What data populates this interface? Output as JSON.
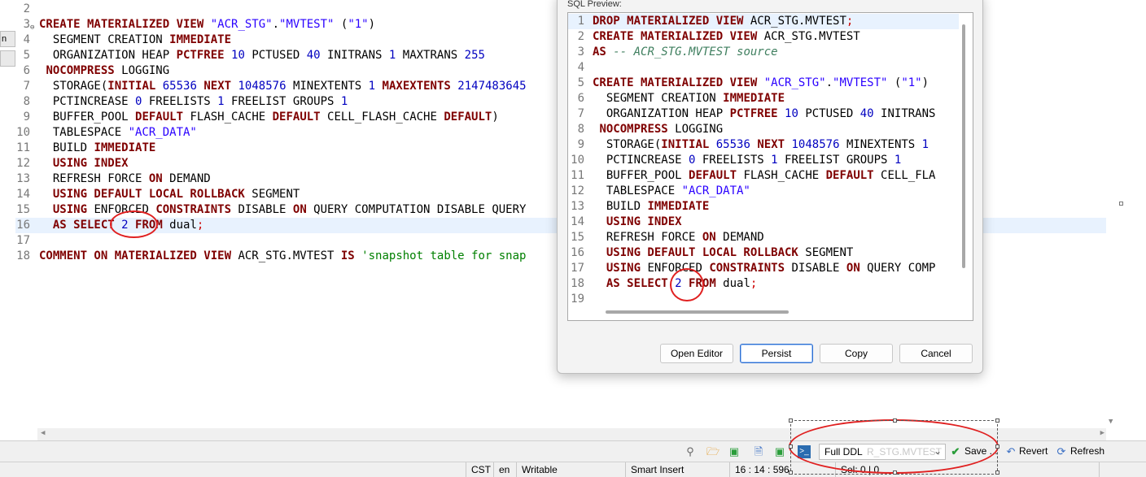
{
  "left_tabs": [
    "n",
    ""
  ],
  "editor": {
    "lines": [
      {
        "n": "2",
        "html": ""
      },
      {
        "n": "3",
        "html": "<span class=\"kw\">CREATE MATERIALIZED VIEW</span> <span class=\"str\">\"ACR_STG\"</span>.<span class=\"str\">\"MVTEST\"</span> (<span class=\"str\">\"1\"</span>)"
      },
      {
        "n": "4",
        "html": "  SEGMENT CREATION <span class=\"kw\">IMMEDIATE</span>"
      },
      {
        "n": "5",
        "html": "  ORGANIZATION HEAP <span class=\"kw\">PCTFREE</span> <span class=\"num\">10</span> PCTUSED <span class=\"num\">40</span> INITRANS <span class=\"num\">1</span> MAXTRANS <span class=\"num\">255</span>"
      },
      {
        "n": "6",
        "html": " <span class=\"kw\">NOCOMPRESS</span> LOGGING"
      },
      {
        "n": "7",
        "html": "  STORAGE(<span class=\"kw\">INITIAL</span> <span class=\"num\">65536</span> <span class=\"kw\">NEXT</span> <span class=\"num\">1048576</span> MINEXTENTS <span class=\"num\">1</span> <span class=\"kw\">MAXEXTENTS</span> <span class=\"num\">2147483645</span>"
      },
      {
        "n": "8",
        "html": "  PCTINCREASE <span class=\"num\">0</span> FREELISTS <span class=\"num\">1</span> FREELIST GROUPS <span class=\"num\">1</span>"
      },
      {
        "n": "9",
        "html": "  BUFFER_POOL <span class=\"kw\">DEFAULT</span> FLASH_CACHE <span class=\"kw\">DEFAULT</span> CELL_FLASH_CACHE <span class=\"kw\">DEFAULT</span>)"
      },
      {
        "n": "10",
        "html": "  TABLESPACE <span class=\"str\">\"ACR_DATA\"</span>"
      },
      {
        "n": "11",
        "html": "  BUILD <span class=\"kw\">IMMEDIATE</span>"
      },
      {
        "n": "12",
        "html": "  <span class=\"kw\">USING INDEX</span>"
      },
      {
        "n": "13",
        "html": "  REFRESH FORCE <span class=\"kw\">ON</span> DEMAND"
      },
      {
        "n": "14",
        "html": "  <span class=\"kw\">USING DEFAULT LOCAL ROLLBACK</span> SEGMENT"
      },
      {
        "n": "15",
        "html": "  <span class=\"kw\">USING</span> ENFORCED <span class=\"kw\">CONSTRAINTS</span> DISABLE <span class=\"kw\">ON</span> QUERY COMPUTATION DISABLE QUERY"
      },
      {
        "n": "16",
        "html": "  <span class=\"kw\">AS SELECT</span> <span class=\"num\">2</span> <span class=\"kw\">FROM</span> dual<span class=\"semi\">;</span>"
      },
      {
        "n": "17",
        "html": ""
      },
      {
        "n": "18",
        "html": "<span class=\"kw\">COMMENT ON MATERIALIZED VIEW</span> ACR_STG.MVTEST <span class=\"kw\">IS</span> <span class=\"gstr\">'snapshot table for snap</span>"
      }
    ]
  },
  "dialog": {
    "label": "SQL Preview:",
    "lines": [
      {
        "n": "1",
        "html": "<span class=\"kw\">DROP MATERIALIZED VIEW</span> ACR_STG.MVTEST<span class=\"semi\">;</span>"
      },
      {
        "n": "2",
        "html": "<span class=\"kw\">CREATE MATERIALIZED VIEW</span> ACR_STG.MVTEST"
      },
      {
        "n": "3",
        "html": "<span class=\"kw\">AS</span> <span class=\"cmt\">-- ACR_STG.MVTEST source</span>"
      },
      {
        "n": "4",
        "html": ""
      },
      {
        "n": "5",
        "html": "<span class=\"kw\">CREATE MATERIALIZED VIEW</span> <span class=\"str\">\"ACR_STG\"</span>.<span class=\"str\">\"MVTEST\"</span> (<span class=\"str\">\"1\"</span>)"
      },
      {
        "n": "6",
        "html": "  SEGMENT CREATION <span class=\"kw\">IMMEDIATE</span>"
      },
      {
        "n": "7",
        "html": "  ORGANIZATION HEAP <span class=\"kw\">PCTFREE</span> <span class=\"num\">10</span> PCTUSED <span class=\"num\">40</span> INITRANS"
      },
      {
        "n": "8",
        "html": " <span class=\"kw\">NOCOMPRESS</span> LOGGING"
      },
      {
        "n": "9",
        "html": "  STORAGE(<span class=\"kw\">INITIAL</span> <span class=\"num\">65536</span> <span class=\"kw\">NEXT</span> <span class=\"num\">1048576</span> MINEXTENTS <span class=\"num\">1</span>"
      },
      {
        "n": "10",
        "html": "  PCTINCREASE <span class=\"num\">0</span> FREELISTS <span class=\"num\">1</span> FREELIST GROUPS <span class=\"num\">1</span>"
      },
      {
        "n": "11",
        "html": "  BUFFER_POOL <span class=\"kw\">DEFAULT</span> FLASH_CACHE <span class=\"kw\">DEFAULT</span> CELL_FLA"
      },
      {
        "n": "12",
        "html": "  TABLESPACE <span class=\"str\">\"ACR_DATA\"</span>"
      },
      {
        "n": "13",
        "html": "  BUILD <span class=\"kw\">IMMEDIATE</span>"
      },
      {
        "n": "14",
        "html": "  <span class=\"kw\">USING INDEX</span>"
      },
      {
        "n": "15",
        "html": "  REFRESH FORCE <span class=\"kw\">ON</span> DEMAND"
      },
      {
        "n": "16",
        "html": "  <span class=\"kw\">USING DEFAULT LOCAL ROLLBACK</span> SEGMENT"
      },
      {
        "n": "17",
        "html": "  <span class=\"kw\">USING</span> ENFORCED <span class=\"kw\">CONSTRAINTS</span> DISABLE <span class=\"kw\">ON</span> QUERY COMP"
      },
      {
        "n": "18",
        "html": "  <span class=\"kw\">AS SELECT</span> <span class=\"num\">2</span> <span class=\"kw\">FROM</span> dual<span class=\"semi\">;</span>"
      },
      {
        "n": "19",
        "html": ""
      }
    ],
    "buttons": {
      "open_editor": "Open Editor",
      "persist": "Persist",
      "copy": "Copy",
      "cancel": "Cancel"
    }
  },
  "toolbar": {
    "ddl_select": "Full DDL",
    "ddl_ghost": "R_STG.MVTEST",
    "save": "Save ...",
    "revert": "Revert",
    "refresh": "Refresh"
  },
  "statusbar": {
    "tz": "CST",
    "locale": "en",
    "mode": "Writable",
    "insert": "Smart Insert",
    "position": "16 : 14 : 596",
    "selection": "Sel: 0 | 0"
  },
  "colors": {
    "keyword": "#7f0000",
    "string": "#2a00ff",
    "number": "#0000c0",
    "comment": "#3f7f5f",
    "annotation": "#e02020"
  }
}
